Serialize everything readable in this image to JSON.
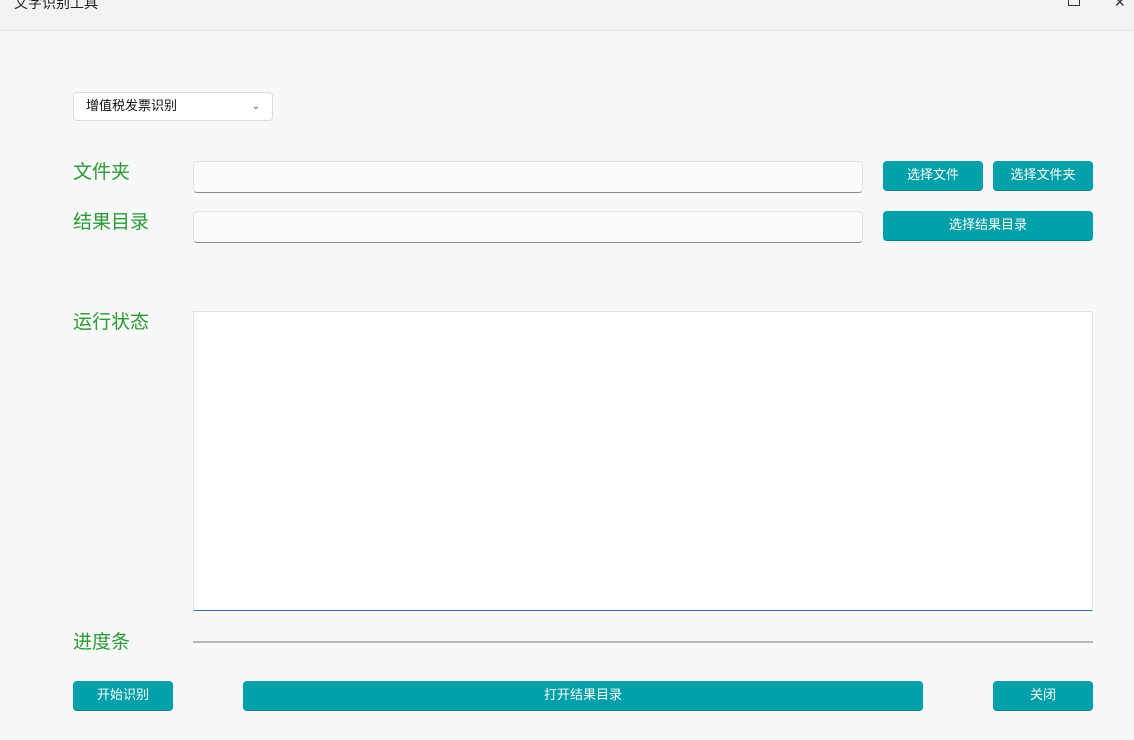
{
  "window": {
    "title": "文字识别工具",
    "close_symbol": "✕"
  },
  "mode_select": {
    "selected": "增值税发票识别",
    "chevron": "⌄"
  },
  "labels": {
    "folder": "文件夹",
    "result_dir": "结果目录",
    "run_status": "运行状态",
    "progress": "进度条"
  },
  "inputs": {
    "folder_value": "",
    "result_dir_value": "",
    "status_text": ""
  },
  "buttons": {
    "select_file": "选择文件",
    "select_folder": "选择文件夹",
    "select_result_dir": "选择结果目录",
    "start": "开始识别",
    "open_result_dir": "打开结果目录",
    "close": "关闭"
  },
  "progress": {
    "value": 0
  },
  "colors": {
    "accent": "#00a0ab",
    "label_green": "#2b9a34",
    "background": "#f7f8f8"
  }
}
